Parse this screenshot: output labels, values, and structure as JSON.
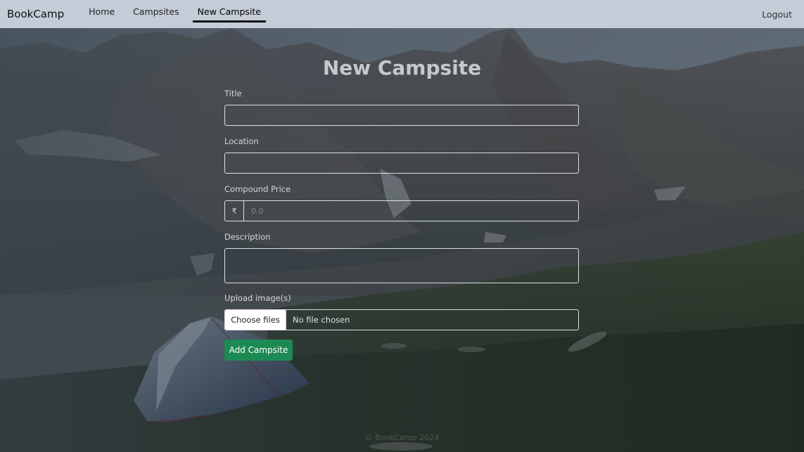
{
  "brand": "BookCamp",
  "nav": {
    "links": [
      {
        "label": "Home"
      },
      {
        "label": "Campsites"
      },
      {
        "label": "New Campsite"
      }
    ],
    "active_index": 2,
    "logout": "Logout"
  },
  "page": {
    "title": "New Campsite"
  },
  "form": {
    "title_label": "Title",
    "title_value": "",
    "location_label": "Location",
    "location_value": "",
    "price_label": "Compound Price",
    "price_prefix": "₹",
    "price_placeholder": "0.0",
    "price_value": "",
    "description_label": "Description",
    "description_value": "",
    "upload_label": "Upload image(s)",
    "upload_button": "Choose files",
    "upload_status": "No file chosen",
    "submit_label": "Add Campsite"
  },
  "footer": {
    "text": "© BookCamp 2024"
  },
  "colors": {
    "navbar_bg": "#c4ccd8",
    "submit_bg": "#1e8a53",
    "active_underline": "#111111"
  },
  "icons": {
    "background": "mountain-landscape-with-tent"
  }
}
